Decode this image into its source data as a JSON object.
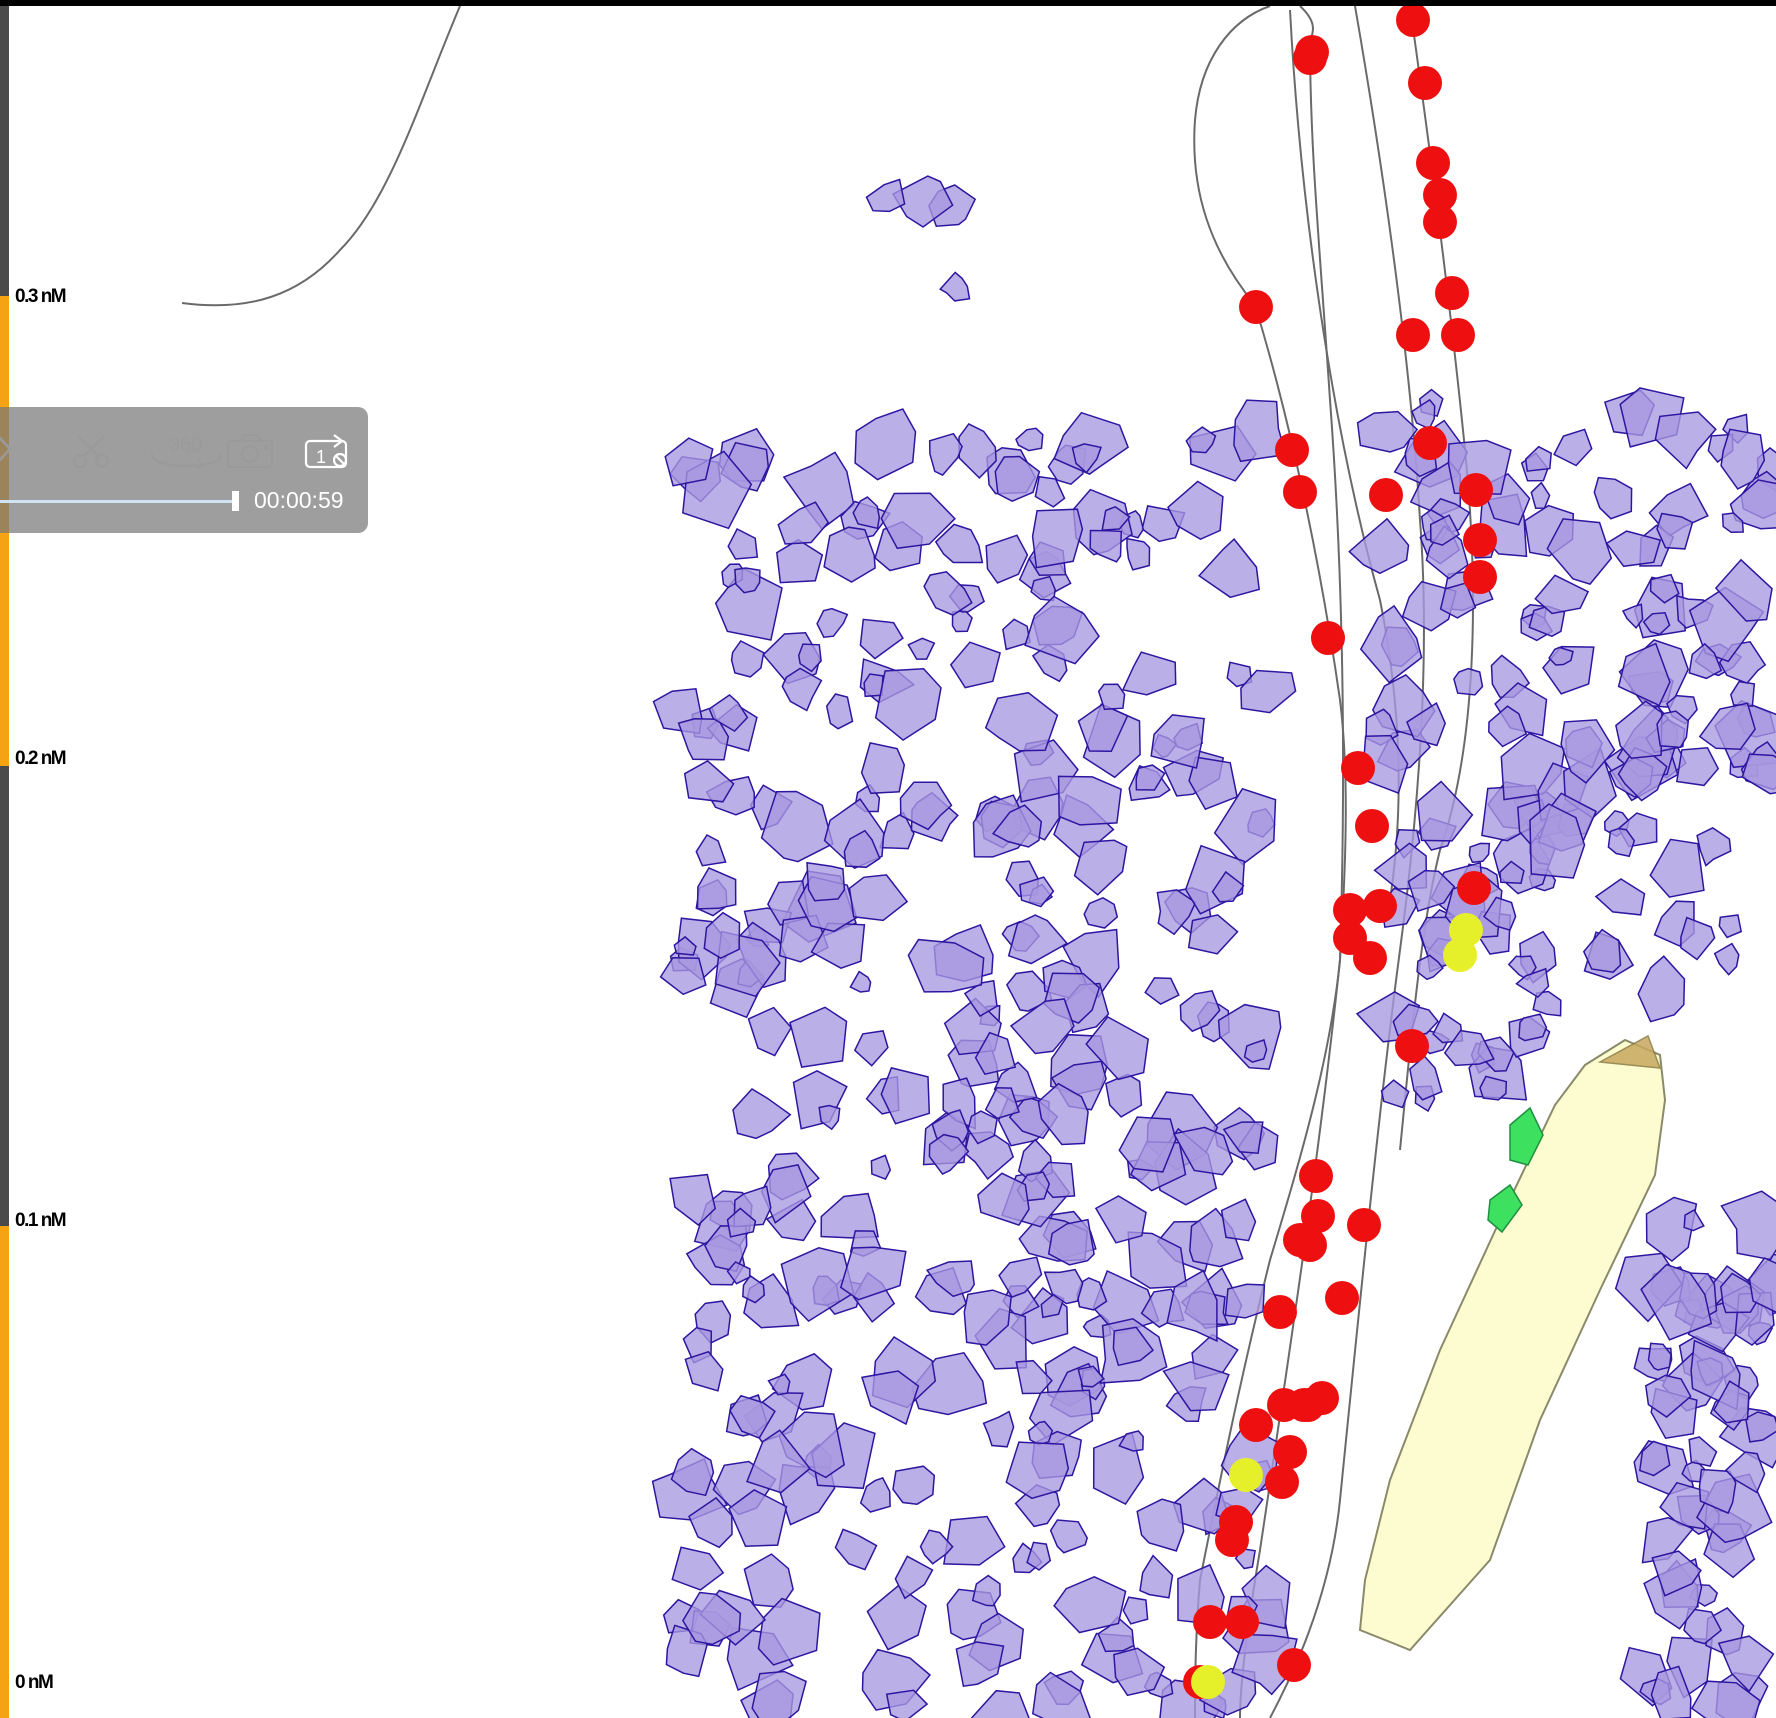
{
  "scale_bar": {
    "unit": "nM",
    "labels": [
      "0.3 nM",
      "0.2 nM",
      "0.1 nM",
      "0 nM"
    ],
    "colors": [
      "#4a4a4a",
      "#f5a312",
      "#4a4a4a",
      "#f5a312"
    ]
  },
  "player": {
    "icons": [
      "play-icon",
      "scissors-icon",
      "360-view-icon",
      "camera-icon",
      "playback-speed-icon"
    ],
    "speed_label": "1",
    "view_label": "360",
    "time": "00:00:59"
  },
  "colors": {
    "cell_fill": "#a898e0",
    "cell_stroke": "#2d16a0",
    "red_dot": "#ee1010",
    "yellow_dot": "#e6f02a",
    "green_shape": "#3ee060",
    "vessel_fill": "#fdfbd0",
    "trajectory": "#6a6a6a"
  }
}
